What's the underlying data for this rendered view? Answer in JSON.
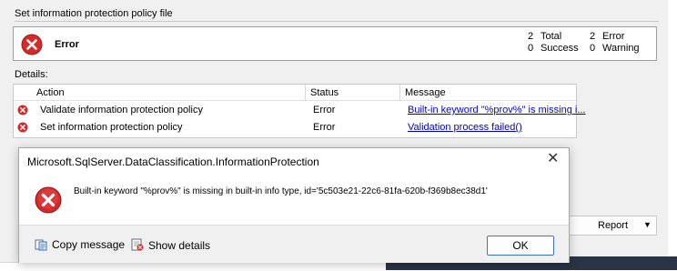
{
  "window": {
    "section_title": "Set information protection policy file",
    "summary": {
      "title": "Error",
      "total_count": "2",
      "total_label": "Total",
      "error_count": "2",
      "error_label": "Error",
      "success_count": "0",
      "success_label": "Success",
      "warning_count": "0",
      "warning_label": "Warning"
    },
    "details_label": "Details:",
    "grid": {
      "columns": [
        "Action",
        "Status",
        "Message"
      ],
      "rows": [
        {
          "action": "Validate information protection policy",
          "status": "Error",
          "message": "Built-in keyword \"%prov%\" is missing i..."
        },
        {
          "action": "Set information protection policy",
          "status": "Error",
          "message": "Validation process failed()"
        }
      ]
    },
    "report_button": "Report"
  },
  "dialog": {
    "title": "Microsoft.SqlServer.DataClassification.InformationProtection",
    "close_glyph": "✕",
    "message": "Built-in keyword \"%prov%\" is missing in built-in info type, id='5c503e21-22c6-81fa-620b-f369b8ec38d1'",
    "copy_label": "Copy message",
    "details_label": "Show details",
    "ok_label": "OK"
  },
  "colors": {
    "error_red": "#d42a2a",
    "link_blue": "#0000d8",
    "ok_border": "#3a74c9"
  },
  "icons": [
    "error-icon",
    "copy-icon",
    "details-icon",
    "close-icon",
    "chevron-down-icon"
  ]
}
